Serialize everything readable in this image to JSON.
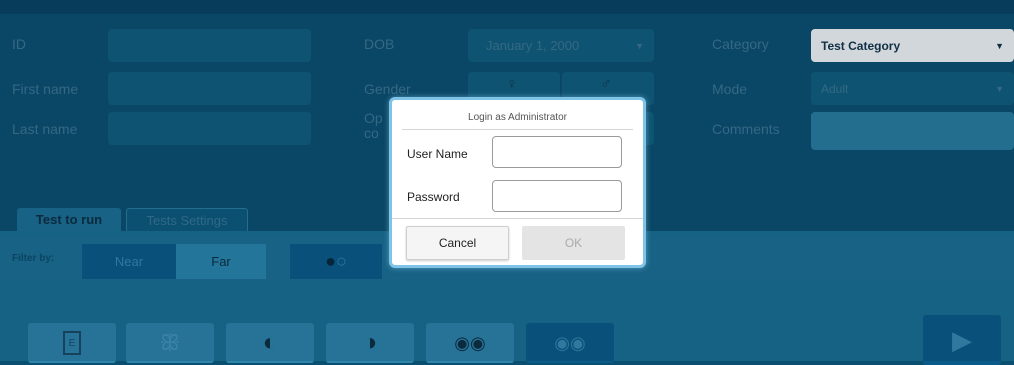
{
  "form": {
    "id_label": "ID",
    "first_name_label": "First name",
    "last_name_label": "Last name",
    "dob_label": "DOB",
    "dob_value": "January 1, 2000",
    "gender_label": "Gender",
    "op_label_line1": "Op",
    "op_label_line2": "co",
    "category_label": "Category",
    "category_value": "Test Category",
    "mode_label": "Mode",
    "mode_value": "Adult",
    "comments_label": "Comments"
  },
  "tabs": {
    "test_to_run": "Test to run",
    "tests_settings": "Tests Settings"
  },
  "filter": {
    "label": "Filter by:",
    "near": "Near",
    "far": "Far"
  },
  "dialog": {
    "title": "Login as Administrator",
    "username_label": "User Name",
    "password_label": "Password",
    "username_value": "",
    "password_value": "",
    "cancel": "Cancel",
    "ok": "OK"
  },
  "icons": [
    "eye-chart-icon",
    "butterfly-icon",
    "contrast-icon",
    "color-contrast-icon",
    "eyes-icon",
    "night-eyes-icon",
    "play-icon",
    "female-icon",
    "male-icon"
  ],
  "colors": {
    "background": "#0b4f70",
    "dialog_border": "#7fc3e6",
    "accent": "#0a5b8a"
  }
}
